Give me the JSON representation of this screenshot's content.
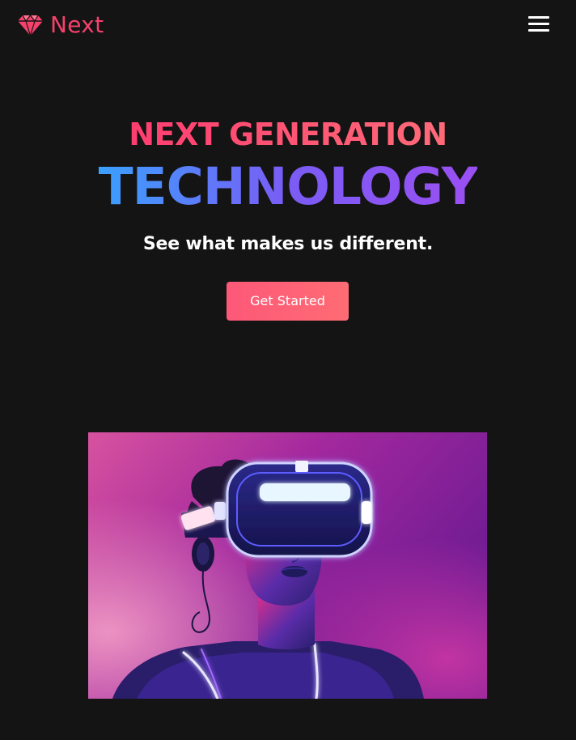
{
  "brand": {
    "name": "Next",
    "icon": "diamond-icon",
    "color": "#f5416c"
  },
  "nav": {
    "menu_icon": "hamburger-menu-icon"
  },
  "hero": {
    "line1": "NEXT GENERATION",
    "line2": "TECHNOLOGY",
    "tagline": "See what makes us different.",
    "cta_label": "Get Started"
  },
  "image": {
    "subject": "vr-headset-neon-portrait"
  },
  "colors": {
    "background": "#141414",
    "accent_pink": "#fd5878",
    "accent_blue": "#3aa0ff",
    "accent_purple": "#8a55f5"
  }
}
